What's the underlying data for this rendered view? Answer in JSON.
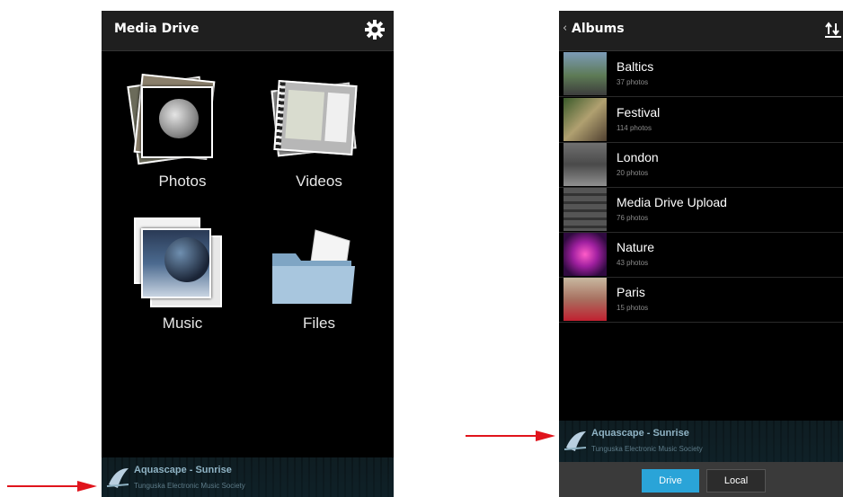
{
  "left_screen": {
    "app_title": "Media Drive",
    "settings_icon": "gear-icon",
    "tiles": [
      {
        "label": "Photos",
        "icon": "photos-stack-icon"
      },
      {
        "label": "Videos",
        "icon": "videos-stack-icon"
      },
      {
        "label": "Music",
        "icon": "music-stack-icon"
      },
      {
        "label": "Files",
        "icon": "folder-icon"
      }
    ],
    "player": {
      "song": "Aquascape - Sunrise",
      "artist": "Tunguska Electronic Music Society"
    }
  },
  "right_screen": {
    "back_icon": "chevron-left-icon",
    "title": "Albums",
    "sort_icon": "sort-icon",
    "albums": [
      {
        "name": "Baltics",
        "count": "37 photos"
      },
      {
        "name": "Festival",
        "count": "114 photos"
      },
      {
        "name": "London",
        "count": "20 photos"
      },
      {
        "name": "Media Drive Upload",
        "count": "76 photos"
      },
      {
        "name": "Nature",
        "count": "43 photos"
      },
      {
        "name": "Paris",
        "count": "15 photos"
      }
    ],
    "player": {
      "song": "Aquascape - Sunrise",
      "artist": "Tunguska Electronic Music Society"
    },
    "segments": {
      "drive": "Drive",
      "local": "Local",
      "selected": "Drive"
    }
  },
  "colors": {
    "arrow": "#e0141c",
    "accent": "#2aa4d8",
    "titlebar": "#1f1f1f"
  }
}
